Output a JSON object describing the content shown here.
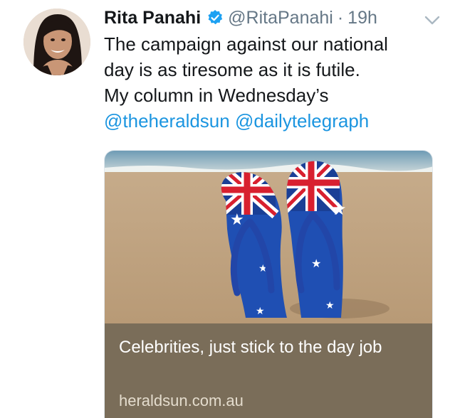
{
  "tweet": {
    "author_name": "Rita Panahi",
    "author_handle": "@RitaPanahi",
    "separator": "·",
    "timestamp": "19h",
    "verified": true,
    "text_lines": [
      "The campaign against our national",
      "day is as tiresome as it is futile.",
      "My column in Wednesday’s"
    ],
    "mentions": [
      "@theheraldsun",
      "@dailytelegraph"
    ]
  },
  "card": {
    "title": "Celebrities, just stick to the day job",
    "domain": "heraldsun.com.au"
  },
  "colors": {
    "mention_blue": "#1b95e0",
    "verified_blue": "#1da1f2",
    "secondary_gray": "#657786",
    "card_footer_bg": "#7a6d59"
  },
  "icons": {
    "verified": "verified-badge-icon",
    "more": "chevron-down-icon"
  }
}
